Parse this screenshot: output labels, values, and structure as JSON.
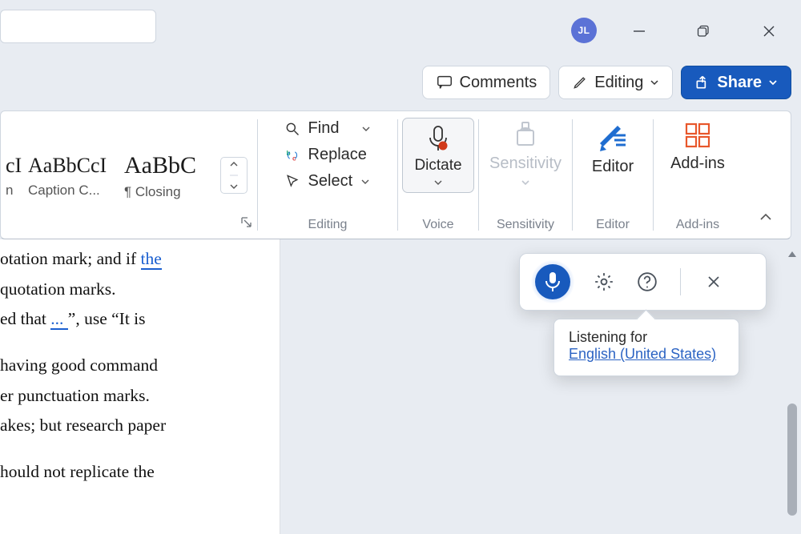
{
  "titlebar": {
    "user_initials": "JL"
  },
  "pills": {
    "comments": "Comments",
    "editing": "Editing",
    "share": "Share"
  },
  "ribbon": {
    "styles": {
      "partial_sample": "cI",
      "partial_name": "n",
      "card1_sample": "AaBbCcI",
      "card1_name": "Caption C...",
      "card2_sample": "AaBbC",
      "card2_name": "¶ Closing"
    },
    "editing": {
      "find": "Find",
      "replace": "Replace",
      "select": "Select",
      "label": "Editing"
    },
    "voice": {
      "dictate": "Dictate",
      "label": "Voice"
    },
    "sensitivity": {
      "btn": "Sensitivity",
      "label": "Sensitivity"
    },
    "editor": {
      "btn": "Editor",
      "label": "Editor"
    },
    "addins": {
      "btn": "Add-ins",
      "label": "Add-ins"
    }
  },
  "doc": {
    "line1a": "otation mark; and if ",
    "line1b": "the",
    "line2": "quotation marks.",
    "line3a": "ed that ",
    "line3b": "... ",
    "line3c": "”, use “It is",
    "line4": "having good command",
    "line5": "er punctuation marks.",
    "line6": "akes; but research paper",
    "line7": "hould not replicate the"
  },
  "tooltip": {
    "title": "Listening for",
    "lang": "English (United States)"
  }
}
